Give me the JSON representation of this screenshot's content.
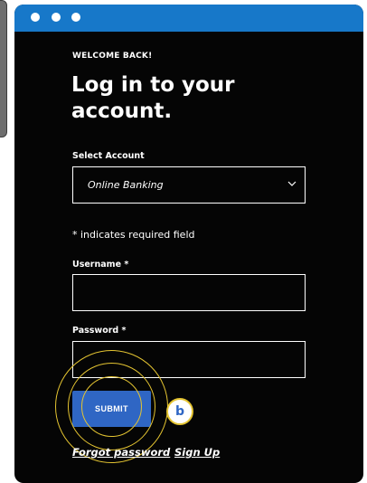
{
  "window": {
    "controls": [
      "window-dot",
      "window-dot",
      "window-dot"
    ]
  },
  "header": {
    "eyebrow": "WELCOME BACK!",
    "title": "Log in to your account."
  },
  "form": {
    "account_label": "Select Account",
    "account_value": "Online Banking",
    "required_note": "* indicates required field",
    "username_label": "Username *",
    "username_value": "",
    "password_label": "Password *",
    "password_value": "",
    "submit_label": "SUBMIT"
  },
  "annotation": {
    "badge": "b"
  },
  "links": {
    "forgot_password": "Forgot password",
    "sign_up": "Sign Up"
  },
  "colors": {
    "titlebar": "#1778c9",
    "background": "#050505",
    "button": "#2f66c4",
    "highlight_ring": "#e4c431"
  },
  "icons": {
    "select_arrow": "chevron-down-icon"
  }
}
